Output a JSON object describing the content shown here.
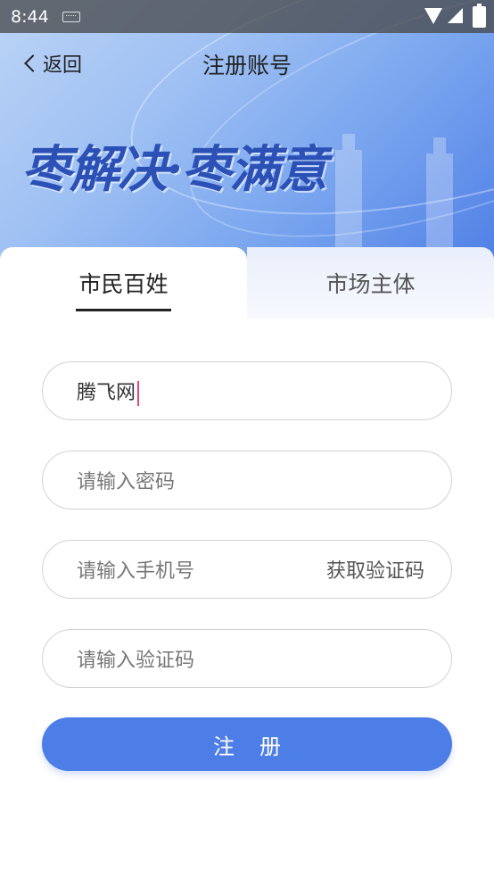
{
  "status_bar": {
    "time": "8:44"
  },
  "header": {
    "back_label": "返回",
    "title": "注册账号",
    "slogan": "枣解决·枣满意"
  },
  "tabs": [
    {
      "label": "市民百姓",
      "active": true
    },
    {
      "label": "市场主体",
      "active": false
    }
  ],
  "form": {
    "username_value": "腾飞网",
    "password_placeholder": "请输入密码",
    "phone_placeholder": "请输入手机号",
    "get_code_label": "获取验证码",
    "code_placeholder": "请输入验证码"
  },
  "register_label": "注册",
  "colors": {
    "accent": "#4d7de6",
    "cursor": "#e24580"
  }
}
